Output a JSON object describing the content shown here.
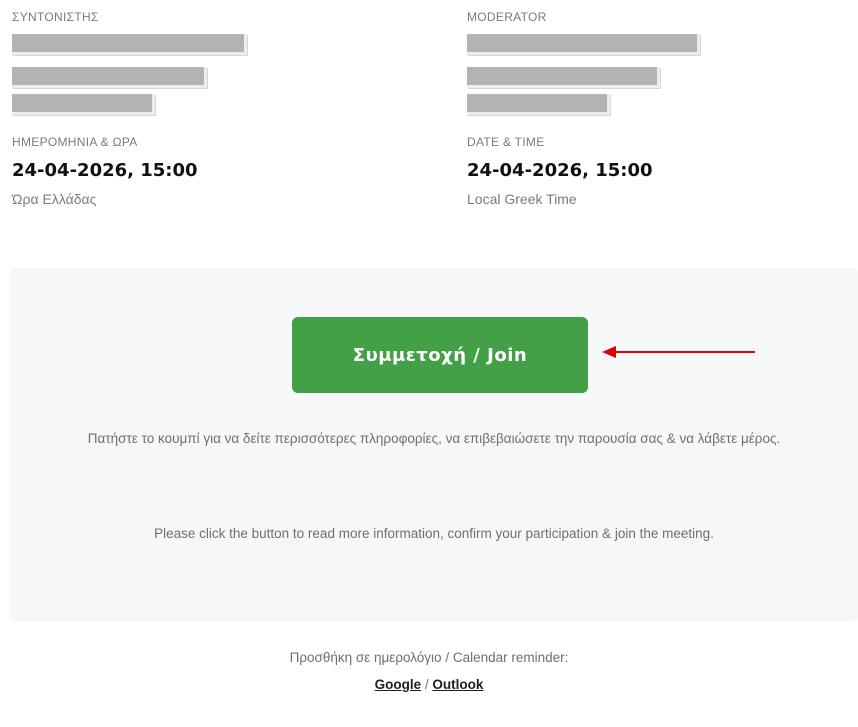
{
  "left": {
    "section_label": "ΣΥΝΤΟΝΙΣΤΗΣ",
    "datetime_label": "ΗΜΕΡΟΜΗΝΙΑ & ΩΡΑ",
    "datetime_value": "24-04-2026, 15:00",
    "timezone": "Ώρα Ελλάδας"
  },
  "right": {
    "section_label": "MODERATOR",
    "datetime_label": "DATE & TIME",
    "datetime_value": "24-04-2026, 15:00",
    "timezone": "Local Greek Time"
  },
  "join": {
    "button_label": "Συμμετοχή / Join",
    "button_color": "#43a047",
    "arrow_color": "#e00000"
  },
  "info": {
    "greek": "Πατήστε το κουμπί για να δείτε περισσότερες πληροφορίες, να επιβεβαιώσετε την παρουσία σας & να λάβετε μέρος.",
    "english": "Please click the button to read more information, confirm your participation & join the meeting."
  },
  "calendar": {
    "label": "Προσθήκη σε ημερολόγιο / Calendar reminder:",
    "google": "Google",
    "separator": "/",
    "outlook": "Outlook"
  }
}
